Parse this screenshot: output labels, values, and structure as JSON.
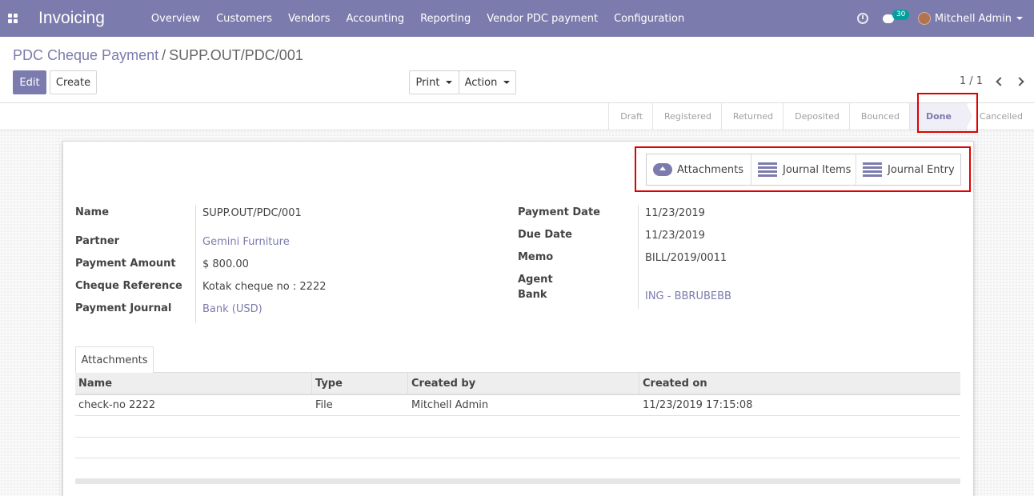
{
  "navbar": {
    "brand": "Invoicing",
    "menu": [
      "Overview",
      "Customers",
      "Vendors",
      "Accounting",
      "Reporting",
      "Vendor PDC payment",
      "Configuration"
    ],
    "chat_count": "30",
    "user_name": "Mitchell Admin"
  },
  "breadcrumb": {
    "parent": "PDC Cheque Payment",
    "separator": "/",
    "current": "SUPP.OUT/PDC/001"
  },
  "buttons": {
    "edit": "Edit",
    "create": "Create",
    "print": "Print",
    "action": "Action"
  },
  "pager": {
    "value": "1 / 1"
  },
  "statusbar": {
    "stages": [
      "Draft",
      "Registered",
      "Returned",
      "Deposited",
      "Bounced",
      "Done",
      "Cancelled"
    ],
    "active": "Done"
  },
  "smart_buttons": {
    "attachments": "Attachments",
    "journal_items": "Journal Items",
    "journal_entry": "Journal Entry"
  },
  "left_fields": [
    {
      "label": "Name",
      "value": "SUPP.OUT/PDC/001"
    },
    {
      "label": "Partner",
      "value": "Gemini Furniture"
    },
    {
      "label": "Payment Amount",
      "value": "$ 800.00"
    },
    {
      "label": "Cheque Reference",
      "value": "Kotak cheque no : 2222"
    },
    {
      "label": "Payment Journal",
      "value": "Bank (USD)"
    }
  ],
  "right_fields": [
    {
      "label": "Payment Date",
      "value": "11/23/2019"
    },
    {
      "label": "Due Date",
      "value": "11/23/2019"
    },
    {
      "label": "Memo",
      "value": "BILL/2019/0011"
    },
    {
      "label": "Agent",
      "label2": "Bank",
      "value": "ING - BBRUBEBB"
    }
  ],
  "notebook": {
    "tab": "Attachments",
    "columns": [
      "Name",
      "Type",
      "Created by",
      "Created on"
    ],
    "rows": [
      [
        "check-no 2222",
        "File",
        "Mitchell Admin",
        "11/23/2019 17:15:08"
      ]
    ]
  },
  "colors": {
    "brand": "#7c7bad",
    "highlight": "#e00000"
  }
}
